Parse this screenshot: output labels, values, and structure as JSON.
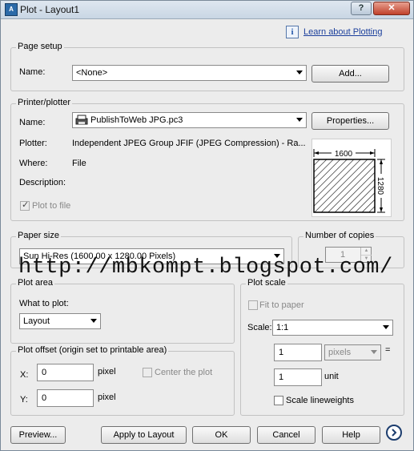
{
  "window": {
    "title": "Plot - Layout1",
    "app_icon": "A"
  },
  "help_link": {
    "label": "Learn about Plotting"
  },
  "page_setup": {
    "legend": "Page setup",
    "name_label": "Name:",
    "name_value": "<None>",
    "add_label": "Add..."
  },
  "printer": {
    "legend": "Printer/plotter",
    "name_label": "Name:",
    "name_value": "PublishToWeb JPG.pc3",
    "properties_label": "Properties...",
    "plotter_label": "Plotter:",
    "plotter_value": "Independent JPEG Group JFIF (JPEG Compression) - Ra...",
    "where_label": "Where:",
    "where_value": "File",
    "description_label": "Description:",
    "plot_to_file_label": "Plot to file",
    "plot_to_file_checked": true,
    "preview_width": "1600",
    "preview_height": "1280"
  },
  "paper_size": {
    "legend": "Paper size",
    "value": "Sun Hi-Res (1600.00 x 1280.00 Pixels)"
  },
  "copies": {
    "legend": "Number of copies",
    "value": "1"
  },
  "watermark": "http://mbkompt.blogspot.com/",
  "plot_area": {
    "legend": "Plot area",
    "what_label": "What to plot:",
    "what_value": "Layout"
  },
  "plot_offset": {
    "legend": "Plot offset (origin set to printable area)",
    "x_label": "X:",
    "x_value": "0",
    "x_unit": "pixel",
    "y_label": "Y:",
    "y_value": "0",
    "y_unit": "pixel",
    "center_label": "Center the plot",
    "center_checked": false
  },
  "plot_scale": {
    "legend": "Plot scale",
    "fit_label": "Fit to paper",
    "fit_checked": false,
    "scale_label": "Scale:",
    "scale_value": "1:1",
    "value1": "1",
    "unit1": "pixels",
    "equals": "=",
    "value2": "1",
    "unit2": "unit",
    "lineweights_label": "Scale lineweights",
    "lineweights_checked": false
  },
  "buttons": {
    "preview": "Preview...",
    "apply": "Apply to Layout",
    "ok": "OK",
    "cancel": "Cancel",
    "help": "Help"
  }
}
